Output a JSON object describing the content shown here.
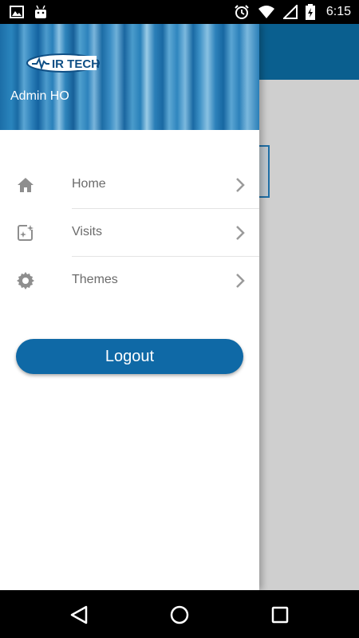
{
  "status_bar": {
    "time": "6:15",
    "left_icons": [
      "image-icon",
      "android-icon"
    ],
    "right_icons": [
      "alarm-icon",
      "wifi-icon",
      "signal-icon",
      "battery-charging-icon"
    ]
  },
  "drawer": {
    "logo_text": "IR TECH",
    "user_name": "Admin HO",
    "menu": [
      {
        "label": "Home",
        "icon": "home-icon"
      },
      {
        "label": "Visits",
        "icon": "visits-icon"
      },
      {
        "label": "Themes",
        "icon": "gear-icon"
      }
    ],
    "logout_label": "Logout"
  },
  "colors": {
    "primary": "#0f69a6",
    "header_bg": "#0a5f8f",
    "scrim": "#cfcfcf"
  },
  "nav_bar": {
    "buttons": [
      "back-icon",
      "home-circle-icon",
      "recents-icon"
    ]
  }
}
